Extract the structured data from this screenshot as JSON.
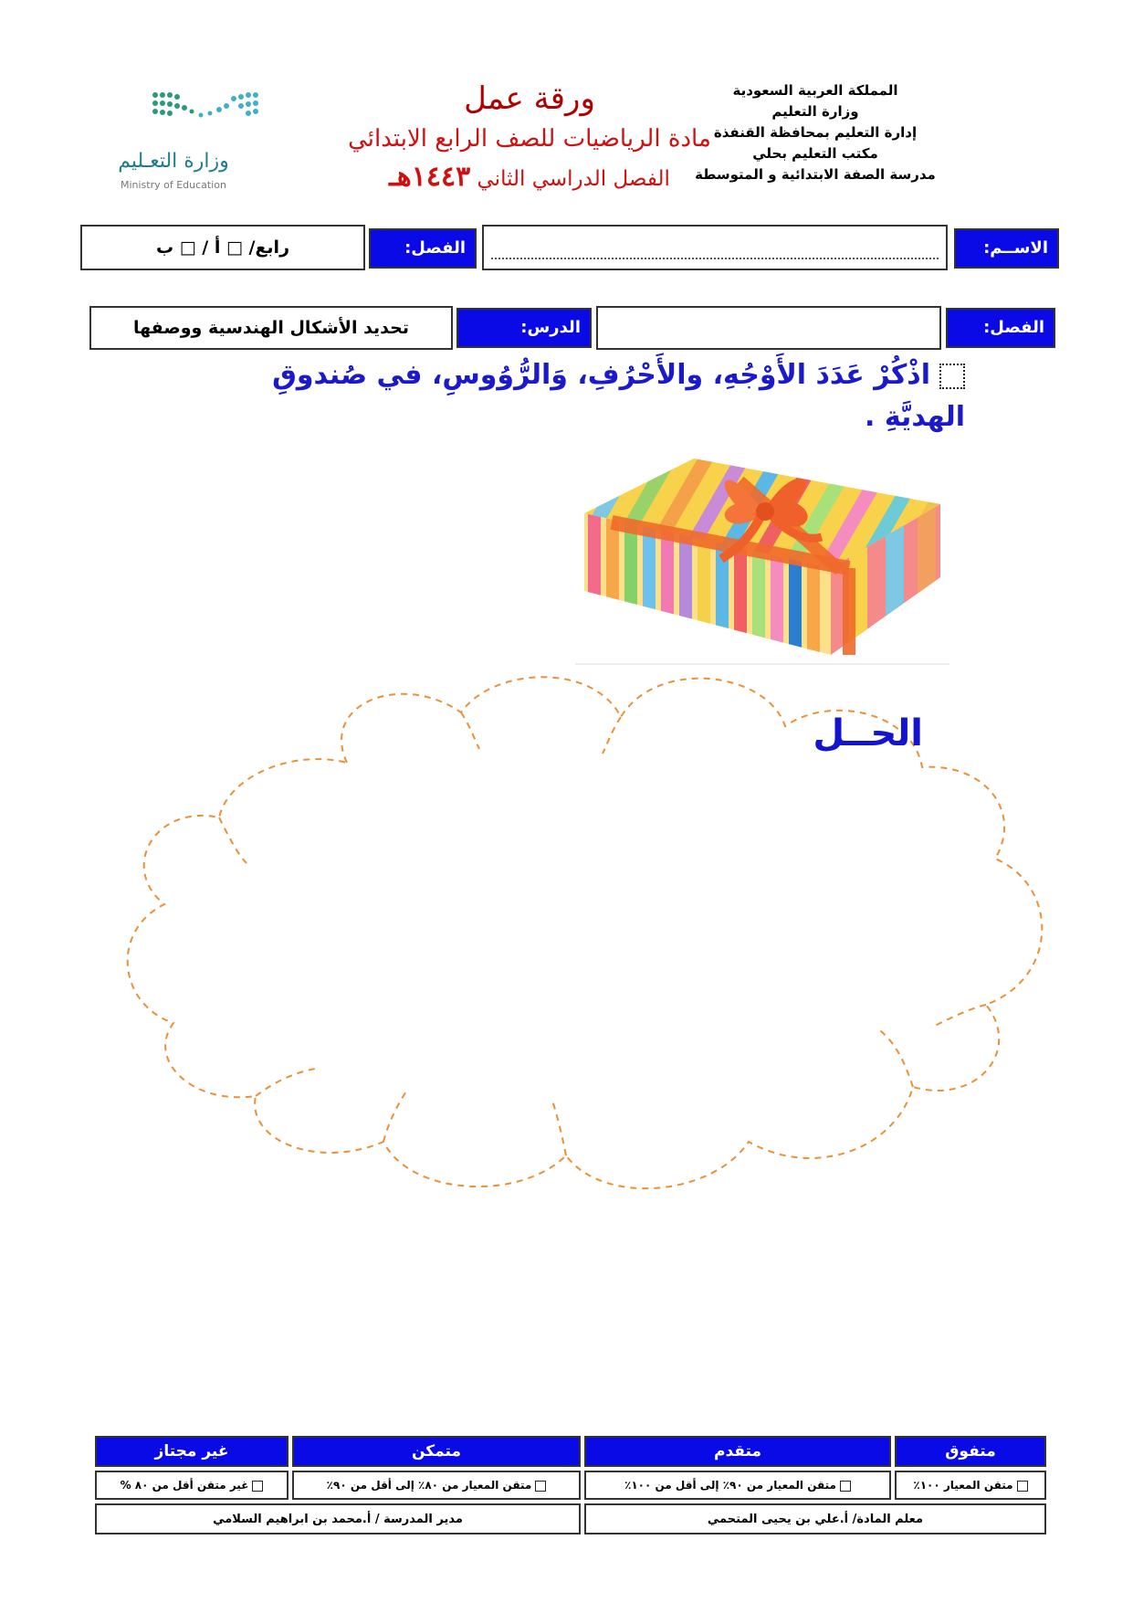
{
  "header": {
    "country": "المملكة العربية السعودية",
    "ministry": "وزارة التعليم",
    "directorate": "إدارة التعليم بمحافظة القنفذة",
    "office": "مكتب التعليم بحلي",
    "school": "مدرسة الصفة الابتدائية و المتوسطة",
    "title": "ورقة عمل",
    "subject": "مادة الرياضيات للصف الرابع الابتدائي",
    "semester": "الفصل الدراسي الثاني",
    "year": "١٤٤٣هـ",
    "logo_ar": "وزارة التعـليم",
    "logo_en": "Ministry of Education"
  },
  "info": {
    "name_label": "الاســم:",
    "class_label": "الفصل:",
    "class_value": "رابع/ □ أ  /  □ ب",
    "chapter_label": "الفصل:",
    "lesson_label": "الدرس:",
    "lesson_value": "تحديد الأشكال الهندسية ووصفها"
  },
  "question": {
    "text": "اذْكُرْ عَدَدَ الأَوْجُهِ، والأَحْرُفِ، وَالرُّوُوسِ، في صُندوقِ الهديَّةِ ."
  },
  "solution_label": "الحــل",
  "colors": {
    "blue": "#0a0ae6",
    "title_red": "#b00000",
    "question_blue": "#1a1acc",
    "cloud": "#e8913a"
  },
  "rubric": {
    "headers": [
      "متفوق",
      "متقدم",
      "متمكن",
      "غير مجتاز"
    ],
    "criteria": [
      "متقن المعيار ١٠٠٪",
      "متقن المعيار من ٩٠٪  إلى أقل من ١٠٠٪",
      "متقن المعيار من ٨٠٪ إلى أقل من ٩٠٪",
      "غير متقن أقل من ٨٠ %"
    ],
    "teacher": "معلم المادة/ أ.علي بن يحيى المتحمي",
    "principal": "مدير المدرسة / أ.محمد بن ابراهيم السلامي"
  }
}
